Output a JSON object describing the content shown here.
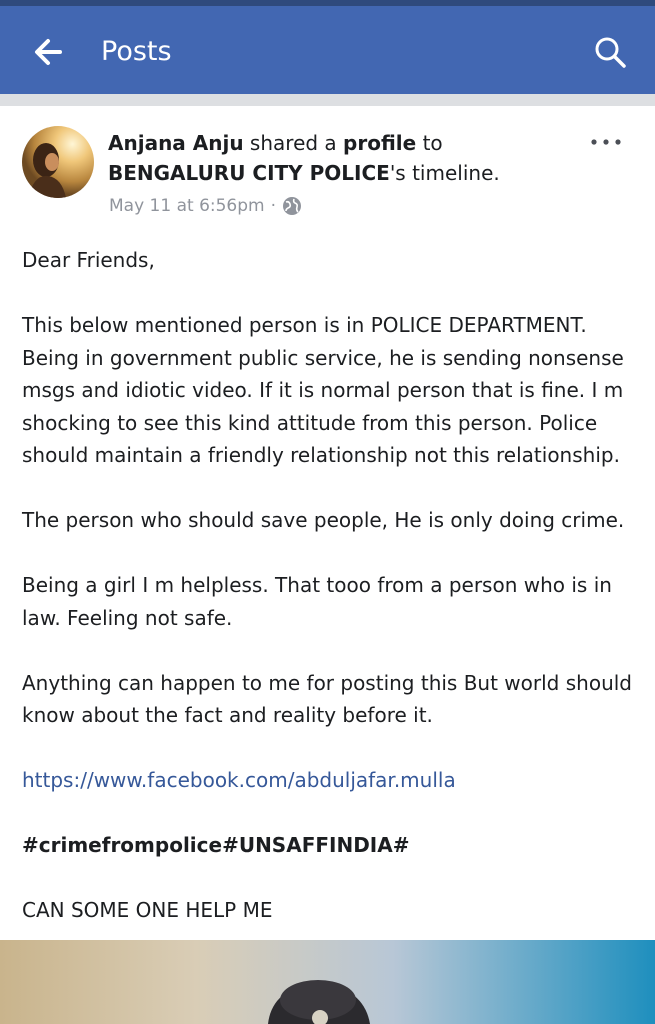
{
  "appbar": {
    "title": "Posts",
    "back_icon": "arrow-left-icon",
    "search_icon": "search-icon",
    "color": "#4267b2"
  },
  "post": {
    "author": "Anjana Anju",
    "action_1": " shared a ",
    "object": "profile",
    "action_2": " to ",
    "target": "BENGALURU CITY POLICE",
    "action_3": "'s timeline.",
    "timestamp": "May 11 at 6:56pm",
    "separator": "·",
    "privacy_icon": "globe-icon",
    "more_icon": "more-dots-icon",
    "paragraphs": [
      "Dear Friends,",
      "This below mentioned person is in POLICE DEPARTMENT. Being in government public service, he is sending nonsense msgs and idiotic video. If it is normal person that is fine. I m shocking to see this kind attitude from this person. Police should maintain a friendly relationship not this relationship.",
      "The person who should save people, He is only doing crime.",
      "Being a girl I m helpless. That tooo from a person who is in law. Feeling not safe.",
      "Anything can happen to me for posting this But world should know about the fact and reality before it."
    ],
    "link": "https://www.facebook.com/abduljafar.mulla",
    "hashtags": "#crimefrompolice#UNSAFFINDIA#",
    "closing": "CAN SOME ONE HELP ME"
  }
}
